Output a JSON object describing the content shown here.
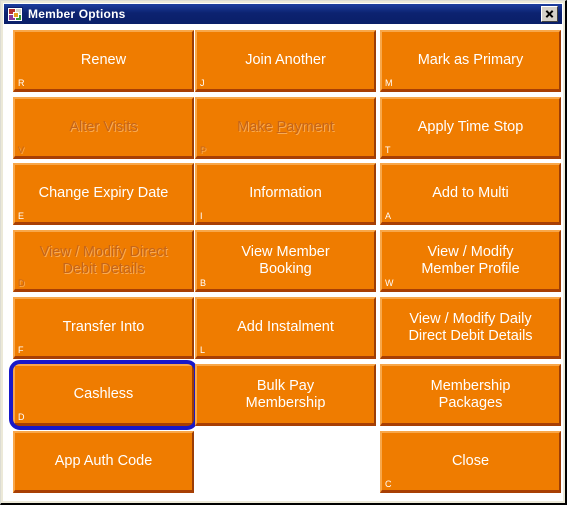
{
  "window": {
    "title": "Member Options",
    "icon": "app-squares-icon",
    "close_button_glyph": "×",
    "accent_color": "#ef7c00",
    "titlebar_color": "#0c2270",
    "focus_ring_color": "#1818c8",
    "disabled_text_color": "#c4651b",
    "label_text_color": "#ffffff"
  },
  "buttons": [
    {
      "label": "Renew",
      "shortcut": "R",
      "disabled": false,
      "focused": false,
      "empty": false,
      "row": 0,
      "col": 0
    },
    {
      "label": "Join Another",
      "shortcut": "J",
      "disabled": false,
      "focused": false,
      "empty": false,
      "row": 0,
      "col": 1
    },
    {
      "label": "Mark as Primary",
      "shortcut": "M",
      "disabled": false,
      "focused": false,
      "empty": false,
      "row": 0,
      "col": 2
    },
    {
      "label": "Alter Visits",
      "shortcut": "V",
      "disabled": true,
      "focused": false,
      "empty": false,
      "row": 1,
      "col": 0
    },
    {
      "label": "Make Payment",
      "shortcut": "P",
      "disabled": true,
      "focused": false,
      "empty": false,
      "row": 1,
      "col": 1,
      "accel_index": 5
    },
    {
      "label": "Apply Time Stop",
      "shortcut": "T",
      "disabled": false,
      "focused": false,
      "empty": false,
      "row": 1,
      "col": 2
    },
    {
      "label": "Change Expiry Date",
      "shortcut": "E",
      "disabled": false,
      "focused": false,
      "empty": false,
      "row": 2,
      "col": 0
    },
    {
      "label": "Information",
      "shortcut": "I",
      "disabled": false,
      "focused": false,
      "empty": false,
      "row": 2,
      "col": 1
    },
    {
      "label": "Add to Multi",
      "shortcut": "A",
      "disabled": false,
      "focused": false,
      "empty": false,
      "row": 2,
      "col": 2
    },
    {
      "label": "View / Modify Direct\nDebit Details",
      "shortcut": "D",
      "disabled": true,
      "focused": false,
      "empty": false,
      "row": 3,
      "col": 0
    },
    {
      "label": "View Member\nBooking",
      "shortcut": "B",
      "disabled": false,
      "focused": false,
      "empty": false,
      "row": 3,
      "col": 1
    },
    {
      "label": "View / Modify\nMember Profile",
      "shortcut": "W",
      "disabled": false,
      "focused": false,
      "empty": false,
      "row": 3,
      "col": 2
    },
    {
      "label": "Transfer Into",
      "shortcut": "F",
      "disabled": false,
      "focused": false,
      "empty": false,
      "row": 4,
      "col": 0
    },
    {
      "label": "Add Instalment",
      "shortcut": "L",
      "disabled": false,
      "focused": false,
      "empty": false,
      "row": 4,
      "col": 1
    },
    {
      "label": "View / Modify Daily\nDirect Debit Details",
      "shortcut": "",
      "disabled": false,
      "focused": false,
      "empty": false,
      "row": 4,
      "col": 2
    },
    {
      "label": "Cashless",
      "shortcut": "D",
      "disabled": false,
      "focused": true,
      "empty": false,
      "row": 5,
      "col": 0
    },
    {
      "label": "Bulk Pay\nMembership",
      "shortcut": "",
      "disabled": false,
      "focused": false,
      "empty": false,
      "row": 5,
      "col": 1
    },
    {
      "label": "Membership\nPackages",
      "shortcut": "",
      "disabled": false,
      "focused": false,
      "empty": false,
      "row": 5,
      "col": 2
    },
    {
      "label": "App Auth Code",
      "shortcut": "",
      "disabled": false,
      "focused": false,
      "empty": false,
      "row": 6,
      "col": 0
    },
    {
      "label": "",
      "shortcut": "",
      "disabled": false,
      "focused": false,
      "empty": true,
      "row": 6,
      "col": 1
    },
    {
      "label": "Close",
      "shortcut": "C",
      "disabled": false,
      "focused": false,
      "empty": false,
      "row": 6,
      "col": 2
    }
  ],
  "layout": {
    "cols": 3,
    "rows": 7,
    "col_x": [
      7,
      189,
      374
    ],
    "row_y": [
      3,
      70,
      136,
      203,
      270,
      337,
      404
    ]
  }
}
